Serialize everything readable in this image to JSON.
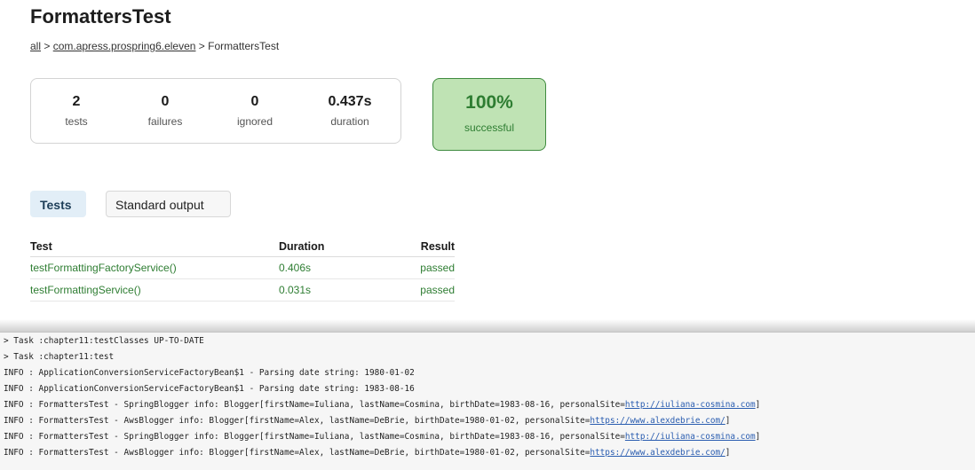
{
  "report": {
    "title": "FormattersTest",
    "breadcrumb": {
      "all": "all",
      "sep1": " > ",
      "package": "com.apress.prospring6.eleven",
      "sep2": " > ",
      "current": "FormattersTest"
    },
    "summary": {
      "tests": {
        "value": "2",
        "label": "tests"
      },
      "failures": {
        "value": "0",
        "label": "failures"
      },
      "ignored": {
        "value": "0",
        "label": "ignored"
      },
      "duration": {
        "value": "0.437s",
        "label": "duration"
      }
    },
    "success": {
      "percent": "100%",
      "label": "successful"
    },
    "tabs": [
      {
        "label": "Tests",
        "active": true
      },
      {
        "label": "Standard output",
        "active": false
      }
    ],
    "table": {
      "headers": [
        "Test",
        "Duration",
        "Result"
      ],
      "rows": [
        {
          "test": "testFormattingFactoryService()",
          "duration": "0.406s",
          "result": "passed"
        },
        {
          "test": "testFormattingService()",
          "duration": "0.031s",
          "result": "passed"
        }
      ]
    }
  },
  "console": {
    "lines": [
      {
        "text": "> Task :chapter11:testClasses UP-TO-DATE"
      },
      {
        "text": "> Task :chapter11:test"
      },
      {
        "text": "INFO : ApplicationConversionServiceFactoryBean$1 - Parsing date string: 1980-01-02"
      },
      {
        "text": "INFO : ApplicationConversionServiceFactoryBean$1 - Parsing date string: 1983-08-16"
      },
      {
        "text": "INFO : FormattersTest - SpringBlogger info: Blogger[firstName=Iuliana, lastName=Cosmina, birthDate=1983-08-16, personalSite=",
        "link": "http://iuliana-cosmina.com",
        "tail": "]"
      },
      {
        "text": "INFO : FormattersTest - AwsBlogger info: Blogger[firstName=Alex, lastName=DeBrie, birthDate=1980-01-02, personalSite=",
        "link": "https://www.alexdebrie.com/",
        "tail": "]"
      },
      {
        "text": "INFO : FormattersTest - SpringBlogger info: Blogger[firstName=Iuliana, lastName=Cosmina, birthDate=1983-08-16, personalSite=",
        "link": "http://iuliana-cosmina.com",
        "tail": "]"
      },
      {
        "text": "INFO : FormattersTest - AwsBlogger info: Blogger[firstName=Alex, lastName=DeBrie, birthDate=1980-01-02, personalSite=",
        "link": "https://www.alexdebrie.com/",
        "tail": "]"
      }
    ]
  },
  "colors": {
    "success_green": "#2e7d32",
    "success_bg": "#bfe3b4",
    "active_tab_bg": "#e2eef7",
    "link_blue": "#2a5db0"
  }
}
